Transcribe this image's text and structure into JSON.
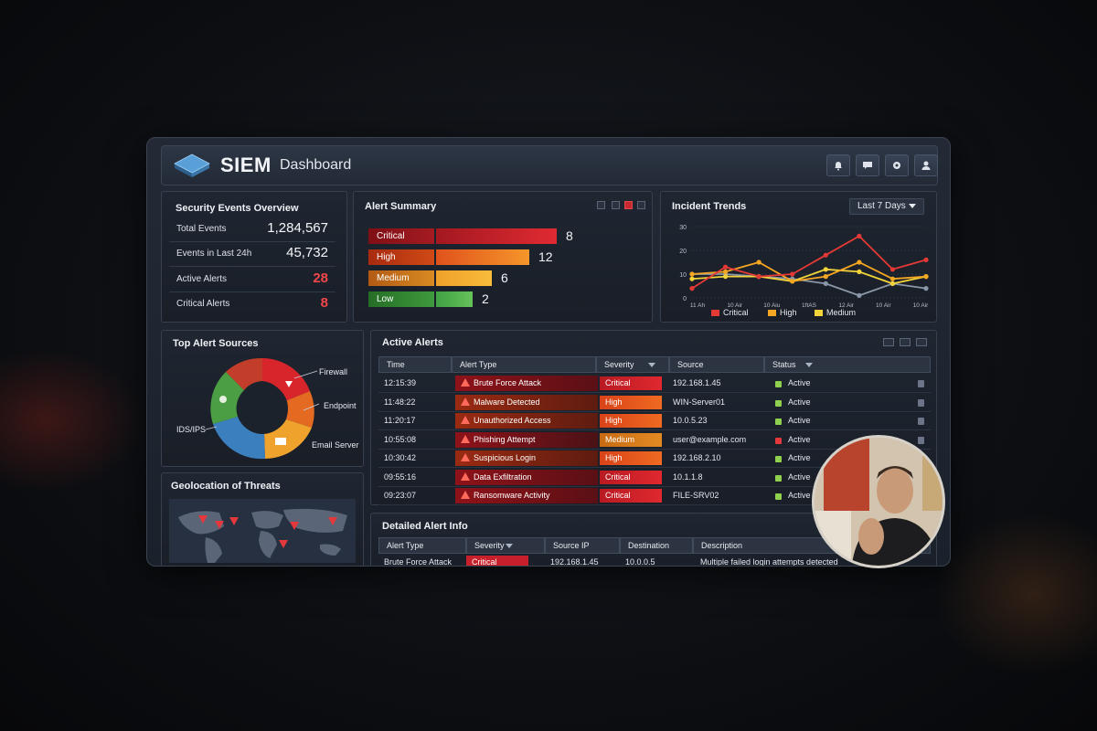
{
  "header": {
    "app_name": "SIEM",
    "app_subtitle": "Dashboard",
    "icons": [
      "bell-icon",
      "chat-icon",
      "settings-icon",
      "user-icon"
    ]
  },
  "overview": {
    "title": "Security Events Overview",
    "rows": [
      {
        "label": "Total Events",
        "value": "1,284,567"
      },
      {
        "label": "Events in Last 24h",
        "value": "45,732"
      },
      {
        "label": "Active Alerts",
        "value": "28"
      },
      {
        "label": "Critical Alerts",
        "value": "8"
      }
    ]
  },
  "alert_summary": {
    "title": "Alert Summary",
    "items": [
      {
        "label": "Critical",
        "count": "8",
        "fraction": 0.89
      },
      {
        "label": "High",
        "count": "12",
        "fraction": 0.69
      },
      {
        "label": "Medium",
        "count": "6",
        "fraction": 0.41
      },
      {
        "label": "Low",
        "count": "2",
        "fraction": 0.27
      }
    ]
  },
  "incident_trends": {
    "title": "Incident Trends",
    "range": "Last 7 Days",
    "legend": [
      "Critical",
      "High",
      "Medium"
    ]
  },
  "chart_data": {
    "type": "line",
    "title": "Incident Trends",
    "y_ticks": [
      "30",
      "20",
      "10",
      "0"
    ],
    "ylim": [
      0,
      30
    ],
    "x_ticks": [
      "11 Ah",
      "10 Air",
      "10 Aiu",
      "1ftAS",
      "12 Air",
      "10 Air",
      "10 Air"
    ],
    "series": [
      {
        "name": "Critical",
        "color": "#e53935",
        "values": [
          4,
          13,
          9,
          10,
          18,
          26,
          12,
          16
        ]
      },
      {
        "name": "High",
        "color": "#f5a623",
        "values": [
          10,
          11,
          15,
          7,
          9,
          15,
          8,
          9
        ]
      },
      {
        "name": "Medium",
        "color": "#f2d43a",
        "values": [
          8,
          9,
          9,
          7,
          12,
          11,
          6,
          9
        ]
      },
      {
        "name": "",
        "color": "#8a97a8",
        "values": [
          10,
          10,
          9,
          8,
          6,
          1,
          6,
          4
        ]
      }
    ]
  },
  "top_sources": {
    "title": "Top Alert Sources",
    "labels": [
      "Firewall",
      "Endpoint",
      "Email Server",
      "IDS/IPS"
    ]
  },
  "geolocation": {
    "title": "Geolocation of Threats"
  },
  "active_alerts": {
    "title": "Active Alerts",
    "columns": [
      "Time",
      "Alert Type",
      "Severity",
      "Source",
      "Status"
    ],
    "rows": [
      {
        "time": "12:15:39",
        "type": "Brute Force Attack",
        "severity": "Critical",
        "source": "192.168.1.45",
        "status": "Active",
        "dot": "#8fd14f"
      },
      {
        "time": "11:48:22",
        "type": "Malware Detected",
        "severity": "High",
        "source": "WIN-Server01",
        "status": "Active",
        "dot": "#8fd14f"
      },
      {
        "time": "11:20:17",
        "type": "Unauthorized Access",
        "severity": "High",
        "source": "10.0.5.23",
        "status": "Active",
        "dot": "#8fd14f"
      },
      {
        "time": "10:55:08",
        "type": "Phishing Attempt",
        "severity": "Medium",
        "source": "user@example.com",
        "status": "Active",
        "dot": "#e5383c"
      },
      {
        "time": "10:30:42",
        "type": "Suspicious Login",
        "severity": "High",
        "source": "192.168.2.10",
        "status": "Active",
        "dot": "#8fd14f"
      },
      {
        "time": "09:55:16",
        "type": "Data Exfiltration",
        "severity": "Critical",
        "source": "10.1.1.8",
        "status": "Active",
        "dot": "#8fd14f"
      },
      {
        "time": "09:23:07",
        "type": "Ransomware Activity",
        "severity": "Critical",
        "source": "FILE-SRV02",
        "status": "Active",
        "dot": "#8fd14f"
      }
    ]
  },
  "detailed": {
    "title": "Detailed Alert Info",
    "columns": [
      "Alert Type",
      "Severity",
      "Source IP",
      "Destination",
      "Description"
    ],
    "row": {
      "type": "Brute Force Attack",
      "severity": "Critical",
      "source_ip": "192.168.1.45",
      "destination": "10.0.0.5",
      "description": "Multiple failed login attempts detected"
    }
  },
  "colors": {
    "critical": "#c8202a",
    "high": "#e8531c",
    "medium": "#e98a1f",
    "low": "#3f9a3c"
  }
}
